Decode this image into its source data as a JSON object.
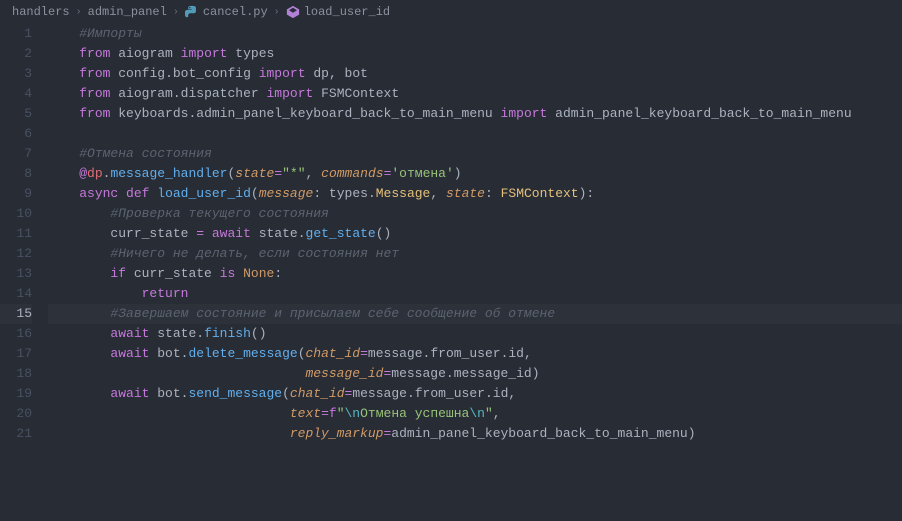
{
  "breadcrumb": {
    "folder": "handlers",
    "subfolder": "admin_panel",
    "file": "cancel.py",
    "symbol": "load_user_id"
  },
  "lines": [
    {
      "n": "1",
      "tokens": [
        [
          "    ",
          ""
        ],
        [
          "#Импорты",
          "c-comment"
        ]
      ]
    },
    {
      "n": "2",
      "tokens": [
        [
          "    ",
          ""
        ],
        [
          "from",
          "c-keyword"
        ],
        [
          " ",
          ""
        ],
        [
          "aiogram",
          "c-module"
        ],
        [
          " ",
          ""
        ],
        [
          "import",
          "c-keyword"
        ],
        [
          " ",
          ""
        ],
        [
          "types",
          "c-module"
        ]
      ]
    },
    {
      "n": "3",
      "tokens": [
        [
          "    ",
          ""
        ],
        [
          "from",
          "c-keyword"
        ],
        [
          " ",
          ""
        ],
        [
          "config",
          "c-module"
        ],
        [
          ".",
          "c-punc"
        ],
        [
          "bot_config",
          "c-module"
        ],
        [
          " ",
          ""
        ],
        [
          "import",
          "c-keyword"
        ],
        [
          " ",
          ""
        ],
        [
          "dp",
          "c-module"
        ],
        [
          ", ",
          "c-punc"
        ],
        [
          "bot",
          "c-module"
        ]
      ]
    },
    {
      "n": "4",
      "tokens": [
        [
          "    ",
          ""
        ],
        [
          "from",
          "c-keyword"
        ],
        [
          " ",
          ""
        ],
        [
          "aiogram",
          "c-module"
        ],
        [
          ".",
          "c-punc"
        ],
        [
          "dispatcher",
          "c-module"
        ],
        [
          " ",
          ""
        ],
        [
          "import",
          "c-keyword"
        ],
        [
          " ",
          ""
        ],
        [
          "FSMContext",
          "c-module"
        ]
      ]
    },
    {
      "n": "5",
      "tokens": [
        [
          "    ",
          ""
        ],
        [
          "from",
          "c-keyword"
        ],
        [
          " ",
          ""
        ],
        [
          "keyboards",
          "c-module"
        ],
        [
          ".",
          "c-punc"
        ],
        [
          "admin_panel_keyboard_back_to_main_menu",
          "c-module"
        ],
        [
          " ",
          ""
        ],
        [
          "import",
          "c-keyword"
        ],
        [
          " ",
          ""
        ],
        [
          "admin_panel_keyboard_back_to_main_menu",
          "c-module"
        ]
      ]
    },
    {
      "n": "6",
      "tokens": [
        [
          "",
          ""
        ]
      ]
    },
    {
      "n": "7",
      "tokens": [
        [
          "    ",
          ""
        ],
        [
          "#Отмена состояния",
          "c-comment"
        ]
      ]
    },
    {
      "n": "8",
      "tokens": [
        [
          "    ",
          ""
        ],
        [
          "@",
          "c-at"
        ],
        [
          "dp",
          "c-var"
        ],
        [
          ".",
          "c-punc"
        ],
        [
          "message_handler",
          "c-decorator"
        ],
        [
          "(",
          "c-punc"
        ],
        [
          "state",
          "c-param"
        ],
        [
          "=",
          "c-op"
        ],
        [
          "\"*\"",
          "c-string"
        ],
        [
          ", ",
          "c-punc"
        ],
        [
          "commands",
          "c-param"
        ],
        [
          "=",
          "c-op"
        ],
        [
          "'отмена'",
          "c-string"
        ],
        [
          ")",
          "c-punc"
        ]
      ]
    },
    {
      "n": "9",
      "tokens": [
        [
          "    ",
          ""
        ],
        [
          "async",
          "c-keyword"
        ],
        [
          " ",
          ""
        ],
        [
          "def",
          "c-keyword"
        ],
        [
          " ",
          ""
        ],
        [
          "load_user_id",
          "c-func"
        ],
        [
          "(",
          "c-punc"
        ],
        [
          "message",
          "c-param"
        ],
        [
          ": ",
          "c-punc"
        ],
        [
          "types",
          "c-module"
        ],
        [
          ".",
          "c-punc"
        ],
        [
          "Message",
          "c-type"
        ],
        [
          ", ",
          "c-punc"
        ],
        [
          "state",
          "c-param"
        ],
        [
          ": ",
          "c-punc"
        ],
        [
          "FSMContext",
          "c-type"
        ],
        [
          "):",
          "c-punc"
        ]
      ]
    },
    {
      "n": "10",
      "tokens": [
        [
          "        ",
          ""
        ],
        [
          "#Проверка текущего состояния",
          "c-comment"
        ]
      ]
    },
    {
      "n": "11",
      "tokens": [
        [
          "        ",
          ""
        ],
        [
          "curr_state ",
          "c-module"
        ],
        [
          "= ",
          "c-op"
        ],
        [
          "await",
          "c-keyword"
        ],
        [
          " ",
          ""
        ],
        [
          "state",
          "c-module"
        ],
        [
          ".",
          "c-punc"
        ],
        [
          "get_state",
          "c-func"
        ],
        [
          "()",
          "c-punc"
        ]
      ]
    },
    {
      "n": "12",
      "tokens": [
        [
          "        ",
          ""
        ],
        [
          "#Ничего не делать, если состояния нет",
          "c-comment"
        ]
      ]
    },
    {
      "n": "13",
      "tokens": [
        [
          "        ",
          ""
        ],
        [
          "if",
          "c-keyword"
        ],
        [
          " ",
          ""
        ],
        [
          "curr_state ",
          "c-module"
        ],
        [
          "is",
          "c-keyword"
        ],
        [
          " ",
          ""
        ],
        [
          "None",
          "c-none"
        ],
        [
          ":",
          "c-punc"
        ]
      ]
    },
    {
      "n": "14",
      "tokens": [
        [
          "            ",
          ""
        ],
        [
          "return",
          "c-keyword"
        ]
      ]
    },
    {
      "n": "15",
      "tokens": [
        [
          "        ",
          ""
        ],
        [
          "#Завершаем состояние и присылаем себе сообщение об отмене",
          "c-comment"
        ]
      ],
      "active": true
    },
    {
      "n": "16",
      "tokens": [
        [
          "        ",
          ""
        ],
        [
          "await",
          "c-keyword"
        ],
        [
          " ",
          ""
        ],
        [
          "state",
          "c-module"
        ],
        [
          ".",
          "c-punc"
        ],
        [
          "finish",
          "c-func"
        ],
        [
          "()",
          "c-punc"
        ]
      ]
    },
    {
      "n": "17",
      "tokens": [
        [
          "        ",
          ""
        ],
        [
          "await",
          "c-keyword"
        ],
        [
          " ",
          ""
        ],
        [
          "bot",
          "c-module"
        ],
        [
          ".",
          "c-punc"
        ],
        [
          "delete_message",
          "c-func"
        ],
        [
          "(",
          "c-punc"
        ],
        [
          "chat_id",
          "c-param"
        ],
        [
          "=",
          "c-op"
        ],
        [
          "message",
          "c-module"
        ],
        [
          ".",
          "c-punc"
        ],
        [
          "from_user",
          "c-module"
        ],
        [
          ".",
          "c-punc"
        ],
        [
          "id",
          "c-module"
        ],
        [
          ",",
          "c-punc"
        ]
      ]
    },
    {
      "n": "18",
      "tokens": [
        [
          "                                 ",
          ""
        ],
        [
          "message_id",
          "c-param"
        ],
        [
          "=",
          "c-op"
        ],
        [
          "message",
          "c-module"
        ],
        [
          ".",
          "c-punc"
        ],
        [
          "message_id",
          "c-module"
        ],
        [
          ")",
          "c-punc"
        ]
      ]
    },
    {
      "n": "19",
      "tokens": [
        [
          "        ",
          ""
        ],
        [
          "await",
          "c-keyword"
        ],
        [
          " ",
          ""
        ],
        [
          "bot",
          "c-module"
        ],
        [
          ".",
          "c-punc"
        ],
        [
          "send_message",
          "c-func"
        ],
        [
          "(",
          "c-punc"
        ],
        [
          "chat_id",
          "c-param"
        ],
        [
          "=",
          "c-op"
        ],
        [
          "message",
          "c-module"
        ],
        [
          ".",
          "c-punc"
        ],
        [
          "from_user",
          "c-module"
        ],
        [
          ".",
          "c-punc"
        ],
        [
          "id",
          "c-module"
        ],
        [
          ",",
          "c-punc"
        ]
      ]
    },
    {
      "n": "20",
      "tokens": [
        [
          "                               ",
          ""
        ],
        [
          "text",
          "c-param"
        ],
        [
          "=",
          "c-op"
        ],
        [
          "f",
          "c-keyword"
        ],
        [
          "\"",
          "c-string"
        ],
        [
          "\\n",
          "c-escape"
        ],
        [
          "Отмена успешна",
          "c-string"
        ],
        [
          "\\n",
          "c-escape"
        ],
        [
          "\"",
          "c-string"
        ],
        [
          ",",
          "c-punc"
        ]
      ]
    },
    {
      "n": "21",
      "tokens": [
        [
          "                               ",
          ""
        ],
        [
          "reply_markup",
          "c-param"
        ],
        [
          "=",
          "c-op"
        ],
        [
          "admin_panel_keyboard_back_to_main_menu",
          "c-module"
        ],
        [
          ")",
          "c-punc"
        ]
      ]
    }
  ]
}
